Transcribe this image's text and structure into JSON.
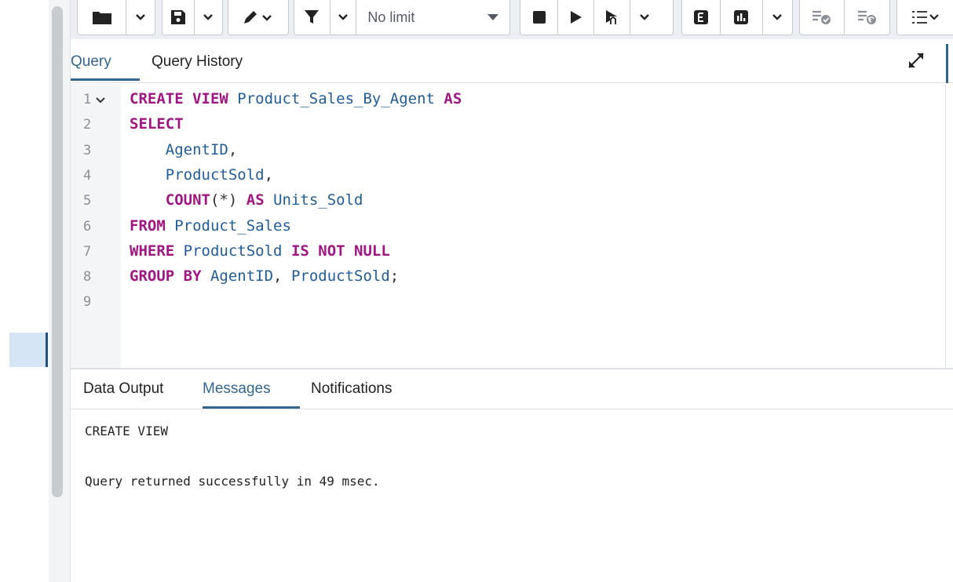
{
  "toolbar": {
    "limit_value": "No limit",
    "icons": [
      "folder-icon",
      "chevron-down-icon",
      "save-icon",
      "chevron-down-icon",
      "edit-pen-icon",
      "filter-icon",
      "chevron-down-icon",
      "stop-icon",
      "execute-icon",
      "execute-script-icon",
      "chevron-down-icon",
      "explain-icon",
      "explain-analyze-icon",
      "chevron-down-icon",
      "commit-icon",
      "rollback-icon",
      "macros-icon"
    ]
  },
  "query_tabs": {
    "tabs": [
      {
        "label": "Query",
        "active": true
      },
      {
        "label": "Query History",
        "active": false
      }
    ]
  },
  "editor": {
    "line_numbers": [
      "1",
      "2",
      "3",
      "4",
      "5",
      "6",
      "7",
      "8",
      "9"
    ],
    "lines": [
      [
        {
          "t": "CREATE VIEW",
          "c": "kw"
        },
        {
          "t": " ",
          "c": "pn"
        },
        {
          "t": "Product_Sales_By_Agent",
          "c": "id"
        },
        {
          "t": " ",
          "c": "pn"
        },
        {
          "t": "AS",
          "c": "kw"
        }
      ],
      [
        {
          "t": "SELECT",
          "c": "kw"
        }
      ],
      [
        {
          "t": "    AgentID",
          "c": "id"
        },
        {
          "t": ",",
          "c": "pn"
        }
      ],
      [
        {
          "t": "    ProductSold",
          "c": "id"
        },
        {
          "t": ",",
          "c": "pn"
        }
      ],
      [
        {
          "t": "    ",
          "c": "pn"
        },
        {
          "t": "COUNT",
          "c": "kw"
        },
        {
          "t": "(*)",
          "c": "pn"
        },
        {
          "t": " ",
          "c": "pn"
        },
        {
          "t": "AS",
          "c": "kw"
        },
        {
          "t": " ",
          "c": "pn"
        },
        {
          "t": "Units_Sold",
          "c": "id"
        }
      ],
      [
        {
          "t": "FROM",
          "c": "kw"
        },
        {
          "t": " ",
          "c": "pn"
        },
        {
          "t": "Product_Sales",
          "c": "id"
        }
      ],
      [
        {
          "t": "WHERE",
          "c": "kw"
        },
        {
          "t": " ",
          "c": "pn"
        },
        {
          "t": "ProductSold",
          "c": "id"
        },
        {
          "t": " ",
          "c": "pn"
        },
        {
          "t": "IS NOT NULL",
          "c": "kw"
        }
      ],
      [
        {
          "t": "GROUP BY",
          "c": "kw"
        },
        {
          "t": " ",
          "c": "pn"
        },
        {
          "t": "AgentID",
          "c": "id"
        },
        {
          "t": ", ",
          "c": "pn"
        },
        {
          "t": "ProductSold",
          "c": "id"
        },
        {
          "t": ";",
          "c": "pn"
        }
      ],
      []
    ]
  },
  "output_tabs": {
    "tabs": [
      {
        "label": "Data Output",
        "active": false
      },
      {
        "label": "Messages",
        "active": true
      },
      {
        "label": "Notifications",
        "active": false
      }
    ]
  },
  "messages": {
    "line1": "CREATE VIEW",
    "line2": "Query returned successfully in 49 msec."
  },
  "colors": {
    "accent": "#326690",
    "keyword": "#a01683",
    "identifier": "#1f5c99"
  }
}
